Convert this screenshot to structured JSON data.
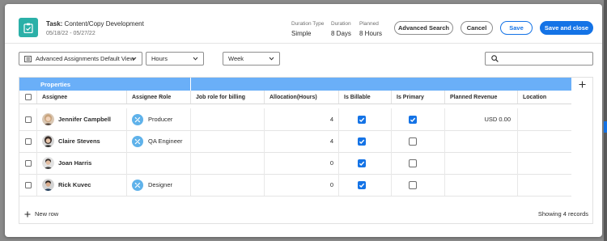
{
  "task": {
    "label": "Task:",
    "name": "Content/Copy Development",
    "dates": "05/18/22 - 05/27/22"
  },
  "meta": {
    "duration_type_label": "Duration Type",
    "duration_type_value": "Simple",
    "duration_label": "Duration",
    "duration_value": "8 Days",
    "planned_label": "Planned",
    "planned_value": "8 Hours"
  },
  "buttons": {
    "advanced_search": "Advanced Search",
    "cancel": "Cancel",
    "save": "Save",
    "save_close": "Save and close"
  },
  "toolbar": {
    "view": "Advanced Assignments Default View",
    "unit": "Hours",
    "period": "Week",
    "search_placeholder": ""
  },
  "grid": {
    "group_label": "Properties",
    "columns": [
      "Assignee",
      "Assignee Role",
      "Job role for billing",
      "Allocation(Hours)",
      "Is Billable",
      "Is Primary",
      "Planned Revenue",
      "Location"
    ],
    "rows": [
      {
        "name": "Jennifer Campbell",
        "role": "Producer",
        "job_role": "",
        "allocation": "4",
        "billable": true,
        "primary": true,
        "revenue": "USD 0.00",
        "location": ""
      },
      {
        "name": "Claire Stevens",
        "role": "QA Engineer",
        "job_role": "",
        "allocation": "4",
        "billable": true,
        "primary": false,
        "revenue": "",
        "location": ""
      },
      {
        "name": "Joan Harris",
        "role": "",
        "job_role": "",
        "allocation": "0",
        "billable": true,
        "primary": false,
        "revenue": "",
        "location": ""
      },
      {
        "name": "Rick Kuvec",
        "role": "Designer",
        "job_role": "",
        "allocation": "0",
        "billable": true,
        "primary": false,
        "revenue": "",
        "location": ""
      }
    ]
  },
  "footer": {
    "new_row": "New row",
    "record_count": "Showing 4 records"
  },
  "colors": {
    "accent": "#1473e6",
    "header_band": "#6aaff8",
    "task_icon": "#2bb0a8",
    "role_icon": "#5fb2ea"
  }
}
